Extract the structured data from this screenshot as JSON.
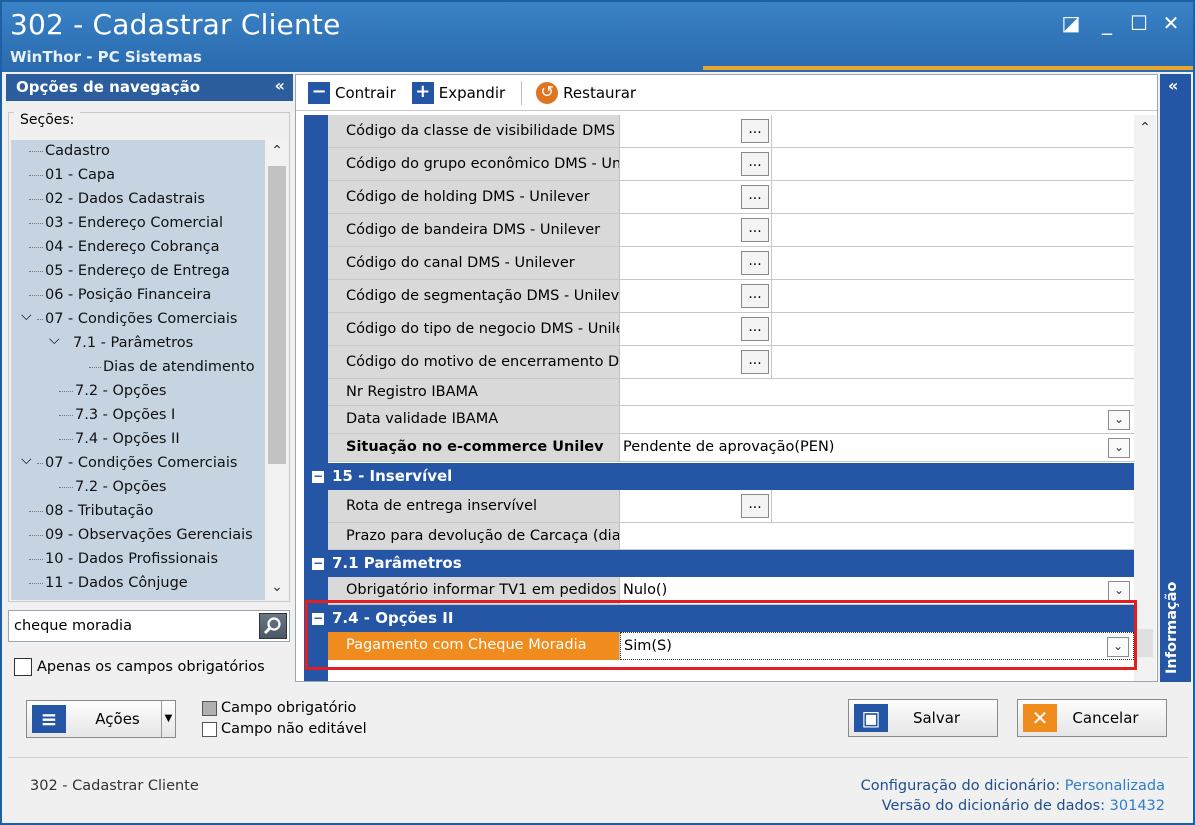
{
  "window": {
    "title": "302 - Cadastrar Cliente",
    "subtitle": "WinThor - PC Sistemas",
    "controls": {
      "restore": "◪",
      "minimize": "_",
      "maximize": "☐",
      "close": "✕"
    }
  },
  "nav": {
    "header": "Opções de navegação",
    "collapse": "«",
    "sections_label": "Seções:",
    "items": [
      {
        "label": "Cadastro"
      },
      {
        "label": "01 - Capa"
      },
      {
        "label": "02 - Dados Cadastrais"
      },
      {
        "label": "03 - Endereço Comercial"
      },
      {
        "label": "04 - Endereço Cobrança"
      },
      {
        "label": "05 - Endereço de Entrega"
      },
      {
        "label": "06 - Posição Financeira"
      },
      {
        "label": "07 - Condições Comerciais"
      },
      {
        "label": "7.1 - Parâmetros"
      },
      {
        "label": "Dias de atendimento"
      },
      {
        "label": "7.2 - Opções"
      },
      {
        "label": "7.3 - Opções I"
      },
      {
        "label": "7.4 - Opções II"
      },
      {
        "label": "07 - Condições Comerciais"
      },
      {
        "label": "7.2 - Opções"
      },
      {
        "label": "08 - Tributação"
      },
      {
        "label": "09 - Observações Gerenciais"
      },
      {
        "label": "10 - Dados Profissionais"
      },
      {
        "label": "11 - Dados Cônjuge"
      }
    ],
    "search_value": "cheque moradia",
    "only_required_label": "Apenas os campos obrigatórios"
  },
  "toolbar": {
    "collapse_label": "Contrair",
    "expand_label": "Expandir",
    "restore_label": "Restaurar"
  },
  "grid": {
    "rows_top": [
      {
        "label": "Código da classe de visibilidade DMS -",
        "value": ""
      },
      {
        "label": "Código do grupo econômico DMS - Un",
        "value": ""
      },
      {
        "label": "Código de holding DMS - Unilever",
        "value": ""
      },
      {
        "label": "Código de bandeira DMS - Unilever",
        "value": ""
      },
      {
        "label": "Código do canal DMS - Unilever",
        "value": ""
      },
      {
        "label": "Código de segmentação DMS - Unilev",
        "value": ""
      },
      {
        "label": "Código do tipo de negocio DMS - Unile",
        "value": ""
      },
      {
        "label": "Código do motivo de encerramento D",
        "value": ""
      }
    ],
    "nr_registro": {
      "label": "Nr Registro IBAMA",
      "value": ""
    },
    "data_validade": {
      "label": "Data validade IBAMA",
      "value": ""
    },
    "situacao": {
      "label": "Situação no e-commerce Unilev",
      "value": "Pendente de aprovação(PEN)"
    },
    "group_15": "15 - Inservível",
    "rota": {
      "label": "Rota de entrega inservível",
      "value": ""
    },
    "prazo": {
      "label": "Prazo para devolução de Carcaça (dia",
      "value": ""
    },
    "group_71": "7.1 Parâmetros",
    "tv1": {
      "label": "Obrigatório informar TV1 em pedidos",
      "value": "Nulo()"
    },
    "group_74": "7.4 - Opções II",
    "cheque": {
      "label": "Pagamento com Cheque Moradia",
      "value": "Sim(S)"
    },
    "ellipsis": "...",
    "dropdown": "⌄"
  },
  "info_tab": {
    "label": "Informação",
    "arrow": "«"
  },
  "bottom": {
    "actions_label": "Ações",
    "legend_required": "Campo obrigatório",
    "legend_noneditable": "Campo não editável",
    "save_label": "Salvar",
    "cancel_label": "Cancelar"
  },
  "footer": {
    "left": "302 - Cadastrar Cliente",
    "config_key": "Configuração do dicionário:",
    "config_value": "Personalizada",
    "version_key": "Versão do dicionário de dados:",
    "version_value": "301432"
  },
  "colors": {
    "accent_blue": "#2456a5",
    "highlight_orange": "#f08c1e",
    "highlight_border": "#e02020"
  }
}
